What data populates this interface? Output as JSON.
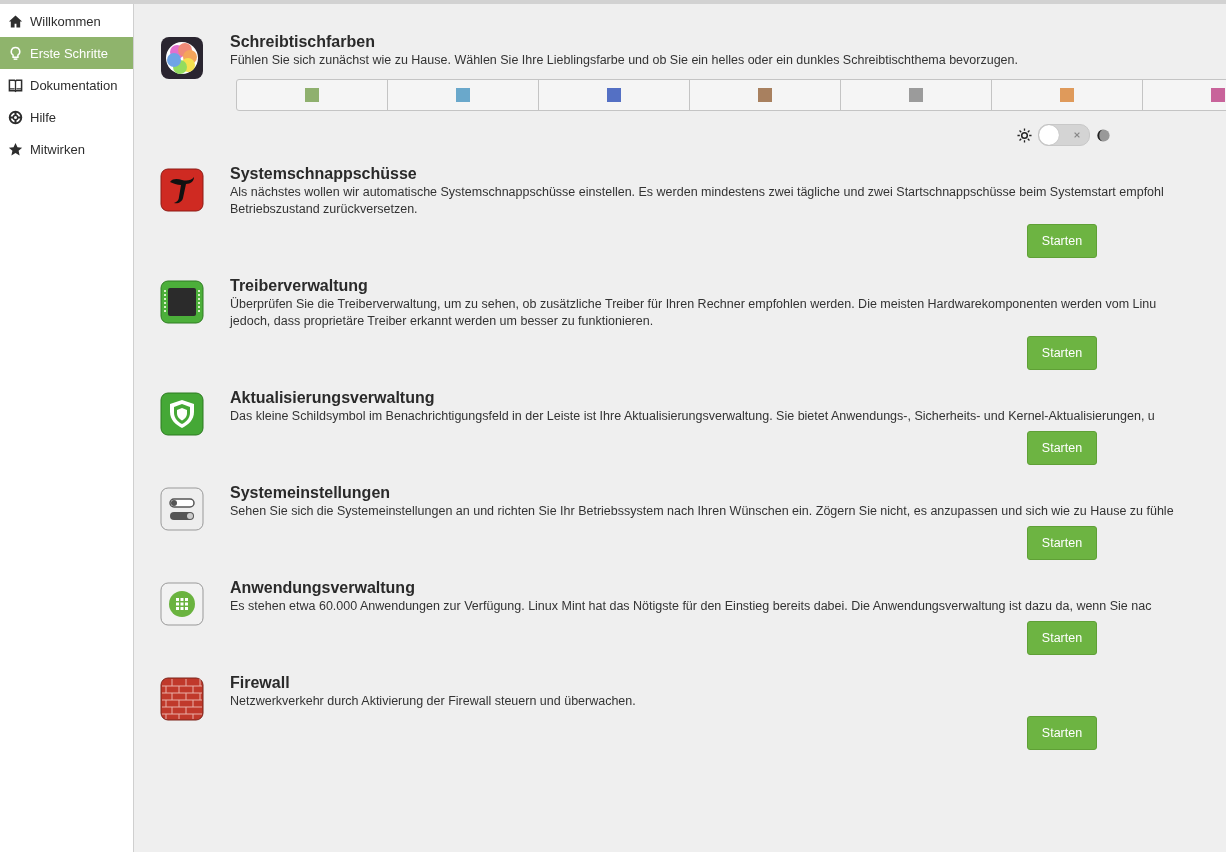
{
  "sidebar": {
    "items": [
      {
        "label": "Willkommen",
        "kind": "home",
        "selected": false
      },
      {
        "label": "Erste Schritte",
        "kind": "bulb",
        "selected": true
      },
      {
        "label": "Dokumentation",
        "kind": "book",
        "selected": false
      },
      {
        "label": "Hilfe",
        "kind": "help",
        "selected": false
      },
      {
        "label": "Mitwirken",
        "kind": "star",
        "selected": false
      }
    ]
  },
  "colors_section": {
    "title": "Schreibtischfarben",
    "lines": [
      "Fühlen Sie sich zunächst wie zu Hause. Wählen Sie Ihre Lieblingsfarbe und ob Sie ein helles oder ein dunkles Schreibtischthema bevorzugen."
    ],
    "swatches": [
      {
        "color": "#8fb06e"
      },
      {
        "color": "#6aa8cb"
      },
      {
        "color": "#5470c4"
      },
      {
        "color": "#a8805f"
      },
      {
        "color": "#9b9b9b"
      },
      {
        "color": "#df9a5b"
      },
      {
        "color": "#c8639a"
      }
    ],
    "dark_theme": false
  },
  "sections": [
    {
      "kind": "snapshot",
      "title": "Systemschnappschüsse",
      "lines": [
        "Als nächstes wollen wir automatische Systemschnappschüsse einstellen. Es werden mindestens zwei tägliche und zwei Startschnappschüsse beim Systemstart empfohl",
        "Betriebszustand zurückversetzen."
      ],
      "button": "Starten"
    },
    {
      "kind": "driver",
      "title": "Treiberverwaltung",
      "lines": [
        "Überprüfen Sie die Treiberverwaltung, um zu sehen, ob zusätzliche Treiber für Ihren Rechner empfohlen werden. Die meisten Hardwarekomponenten werden vom Linu",
        "jedoch, dass proprietäre Treiber erkannt werden um besser zu funktionieren."
      ],
      "button": "Starten"
    },
    {
      "kind": "update",
      "title": "Aktualisierungsverwaltung",
      "lines": [
        "Das kleine Schildsymbol im Benachrichtigungsfeld in der Leiste ist Ihre Aktualisierungsverwaltung. Sie bietet Anwendungs-, Sicherheits- und Kernel-Aktualisierungen, u"
      ],
      "button": "Starten"
    },
    {
      "kind": "settings",
      "title": "Systemeinstellungen",
      "lines": [
        "Sehen Sie sich die Systemeinstellungen an und richten Sie Ihr Betriebssystem nach Ihren Wünschen ein. Zögern Sie nicht, es anzupassen und sich wie zu Hause zu fühle"
      ],
      "button": "Starten"
    },
    {
      "kind": "software",
      "title": "Anwendungsverwaltung",
      "lines": [
        "Es stehen etwa 60.000 Anwendungen zur Verfügung. Linux Mint hat das Nötigste für den Einstieg bereits dabei. Die Anwendungsverwaltung ist dazu da, wenn Sie nac"
      ],
      "button": "Starten"
    },
    {
      "kind": "firewall",
      "title": "Firewall",
      "lines": [
        "Netzwerkverkehr durch Aktivierung der Firewall steuern und überwachen."
      ],
      "button": "Starten"
    }
  ]
}
